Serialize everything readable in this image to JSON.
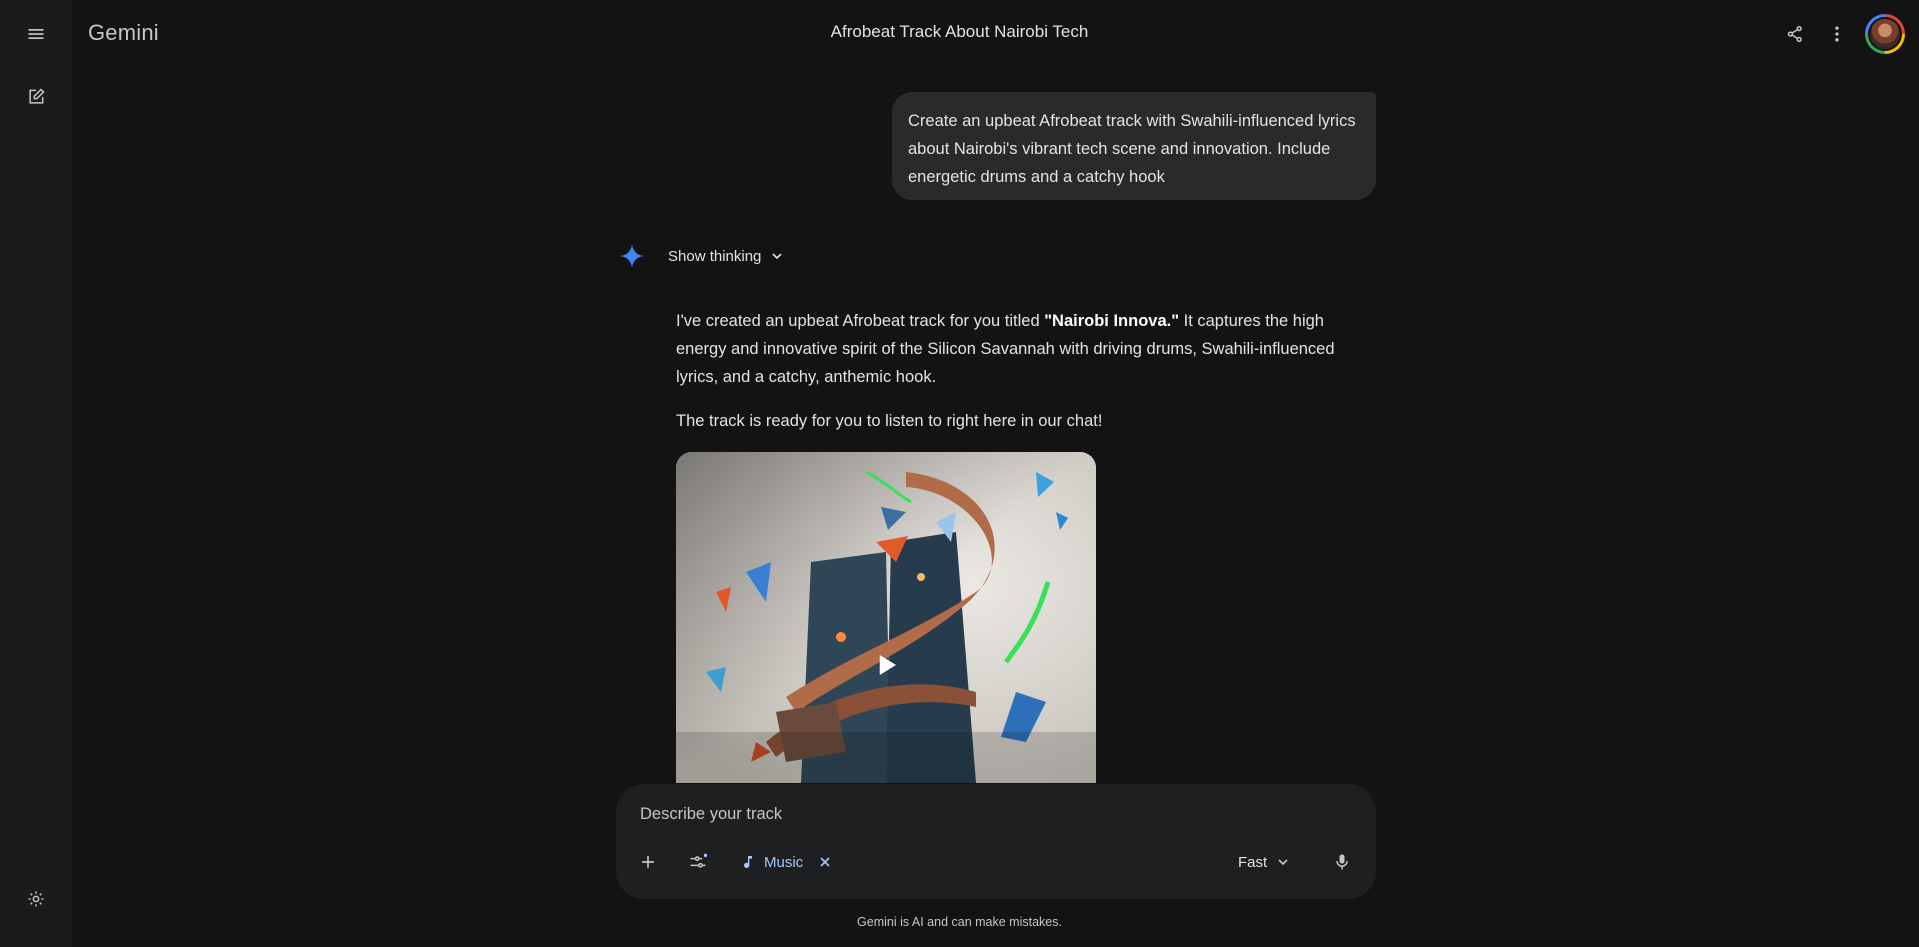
{
  "app": {
    "brand": "Gemini",
    "conversation_title": "Afrobeat Track About Nairobi Tech"
  },
  "rail": {
    "menu_icon": "menu-icon",
    "new_chat_icon": "edit-icon",
    "settings_icon": "gear-icon"
  },
  "header": {
    "share_icon": "share-icon",
    "more_icon": "more-vertical-icon",
    "avatar": "avatar"
  },
  "user_prompt": {
    "text": "Create an upbeat Afrobeat track with Swahili-influenced lyrics about Nairobi's vibrant tech scene and innovation. Include energetic drums and a catchy hook"
  },
  "response": {
    "show_thinking_label": "Show thinking",
    "p1_before": "I've created an upbeat Afrobeat track for you titled ",
    "p1_bold": "\"Nairobi Innova.\"",
    "p1_after": " It captures the high energy and innovative spirit of the Silicon Savannah with driving drums, Swahili-influenced lyrics, and a catchy, anthemic hook.",
    "p2": "The track is ready for you to listen to right here in our chat!",
    "media_play_icon": "play-icon"
  },
  "composer": {
    "placeholder": "Describe your track",
    "add_icon": "plus-icon",
    "tools_icon": "tools-icon",
    "chip_label": "Music",
    "chip_icon": "music-note-icon",
    "mode_label": "Fast",
    "mic_icon": "mic-icon"
  },
  "footer": {
    "disclaimer": "Gemini is AI and can make mistakes."
  },
  "colors": {
    "background": "#131314",
    "rail": "#1b1b1c",
    "bubble": "#282a2c",
    "composer": "#1e1f20",
    "accent": "#a8c7fa",
    "spark": "#4285f4"
  }
}
